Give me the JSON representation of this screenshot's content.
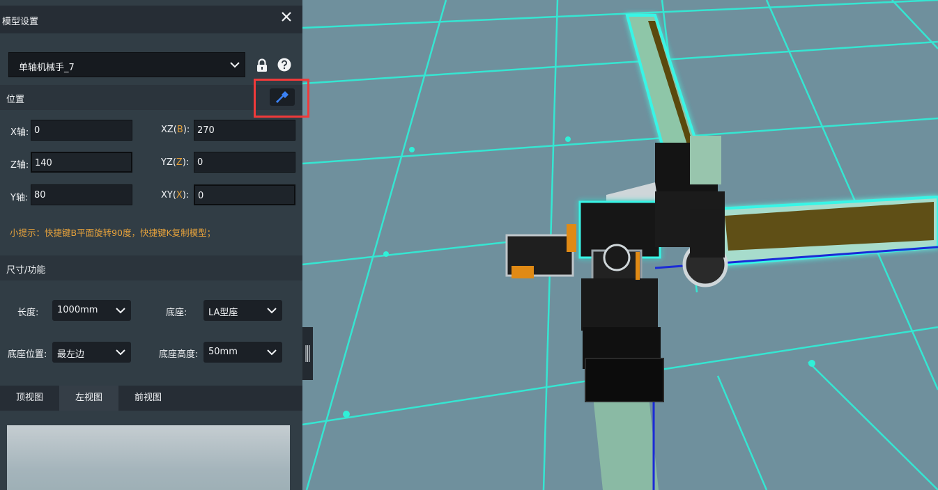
{
  "panel": {
    "title": "模型设置",
    "model_select": {
      "value": "单轴机械手_7"
    },
    "position_section": {
      "title": "位置"
    },
    "position_fields": [
      {
        "label_prefix": "X轴",
        "label_accent": "",
        "label_suffix": ":",
        "value": "0"
      },
      {
        "label_prefix": "Z轴",
        "label_accent": "",
        "label_suffix": ":",
        "value": "140"
      },
      {
        "label_prefix": "Y轴",
        "label_accent": "",
        "label_suffix": ":",
        "value": "80"
      }
    ],
    "rotation_fields": [
      {
        "label_prefix": "XZ(",
        "label_accent": "B",
        "label_suffix": "):",
        "value": "270"
      },
      {
        "label_prefix": "YZ(",
        "label_accent": "Z",
        "label_suffix": "):",
        "value": "0"
      },
      {
        "label_prefix": "XY(",
        "label_accent": "X",
        "label_suffix": "):",
        "value": "0"
      }
    ],
    "tip": "小提示：快捷键B平面旋转90度，快捷键K复制模型；",
    "size_section": {
      "title": "尺寸/功能"
    },
    "length": {
      "label": "长度:",
      "value": "1000mm"
    },
    "base": {
      "label": "底座:",
      "value": "LA型座"
    },
    "base_position": {
      "label": "底座位置:",
      "value": "最左边"
    },
    "base_height": {
      "label": "底座高度:",
      "value": "50mm"
    },
    "view_tabs": [
      {
        "label": "顶视图",
        "active": false
      },
      {
        "label": "左视图",
        "active": true
      },
      {
        "label": "前视图",
        "active": false
      }
    ]
  },
  "colors": {
    "accent": "#e6a23c",
    "grid_line": "#2ff0d8",
    "highlight_box": "#f03a3a",
    "pick_icon": "#3b82f6"
  },
  "icons": [
    "close-icon",
    "chevron-down-icon",
    "lock-icon",
    "help-icon",
    "eyedropper-icon"
  ]
}
